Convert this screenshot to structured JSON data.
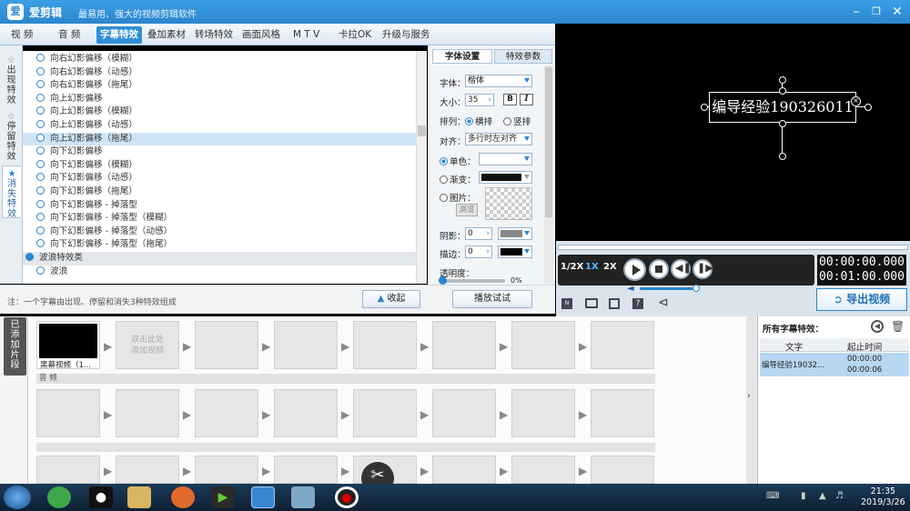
{
  "app": {
    "title": "爱剪辑",
    "slogan": "最易用、强大的视频剪辑软件",
    "logo": "爱"
  },
  "tabs": [
    {
      "label": "视 频"
    },
    {
      "label": "音 频"
    },
    {
      "label": "字幕特效",
      "active": true
    },
    {
      "label": "叠加素材"
    },
    {
      "label": "转场特效"
    },
    {
      "label": "画面风格"
    },
    {
      "label": "M T V"
    },
    {
      "label": "卡拉OK"
    },
    {
      "label": "升级与服务"
    }
  ],
  "vtabs": [
    {
      "label": "出\n现\n特\n效"
    },
    {
      "label": "停\n留\n特\n效"
    },
    {
      "label": "消\n失\n特\n效",
      "active": true
    }
  ],
  "effect_list": [
    {
      "label": "向右幻影偏移（模糊）"
    },
    {
      "label": "向右幻影偏移（动感）"
    },
    {
      "label": "向右幻影偏移（拖尾）"
    },
    {
      "label": "向上幻影偏移"
    },
    {
      "label": "向上幻影偏移（模糊）"
    },
    {
      "label": "向上幻影偏移（动感）"
    },
    {
      "label": "向上幻影偏移（拖尾）",
      "selected": true
    },
    {
      "label": "向下幻影偏移"
    },
    {
      "label": "向下幻影偏移（模糊）"
    },
    {
      "label": "向下幻影偏移（动感）"
    },
    {
      "label": "向下幻影偏移（拖尾）"
    },
    {
      "label": "向下幻影偏移 - 掉落型"
    },
    {
      "label": "向下幻影偏移 - 掉落型（模糊）"
    },
    {
      "label": "向下幻影偏移 - 掉落型（动感）"
    },
    {
      "label": "向下幻影偏移 - 掉落型（拖尾）"
    },
    {
      "label": "波浪特效类",
      "category": true
    },
    {
      "label": "波浪"
    }
  ],
  "props": {
    "tab_font": "字体设置",
    "tab_effect": "特效参数",
    "font_label": "字体：",
    "font_value": "楷体",
    "size_label": "大小：",
    "size_value": "35",
    "bold": "B",
    "italic": "I",
    "layout_label": "排列：",
    "layout_h": "横排",
    "layout_v": "竖排",
    "align_label": "对齐：",
    "align_value": "多行时左对齐",
    "single_color": "单色：",
    "gradient": "渐变：",
    "image": "图片：",
    "browse": "浏览",
    "shadow_label": "阴影：",
    "shadow_value": "0",
    "stroke_label": "描边：",
    "stroke_value": "0",
    "opacity_label": "透明度：",
    "opacity_value": "0%"
  },
  "left_bottom": {
    "note": "注：一个字幕由出现、停留和消失3种特效组成",
    "collapse_button": "收起",
    "play_test_button": "播放试试"
  },
  "preview": {
    "text": "编导经验190326011"
  },
  "player": {
    "speed_half": "1/2X",
    "speed_1x": "1X",
    "speed_2x": "2X",
    "current_time": "00:00:00.000",
    "total_time": "00:01:00.000",
    "export_button": "导出视频"
  },
  "timeline": {
    "section_label": "已\n添\n加\n片\n段",
    "clip_label": "黑幕视频（1...",
    "add_clip_text": "双击此处\n添加视频",
    "audio_label": "音 频"
  },
  "subtitle_panel": {
    "title": "所有字幕特效：",
    "col_text": "文字",
    "col_time": "起止时间",
    "rows": [
      {
        "text": "编导经验19032...",
        "start": "00:00:00",
        "end": "00:00:06"
      }
    ]
  },
  "taskbar": {
    "time": "21:35",
    "date": "2019/3/26"
  },
  "colors": {
    "accent": "#2a86cf",
    "title_bar": "#3b9fe4",
    "selected_row": "#cfe5f7"
  }
}
